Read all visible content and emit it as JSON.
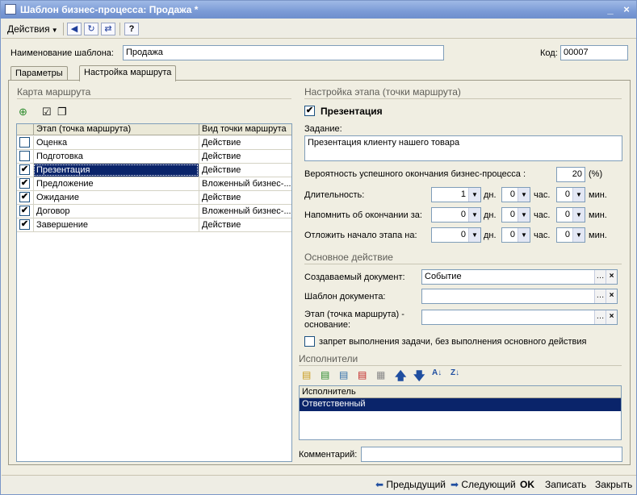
{
  "window": {
    "title": "Шаблон бизнес-процесса: Продажа *"
  },
  "toolbar": {
    "actions_label": "Действия"
  },
  "form": {
    "name_label": "Наименование шаблона:",
    "name_value": "Продажа",
    "code_label": "Код:",
    "code_value": "00007"
  },
  "tabs": [
    {
      "label": "Параметры"
    },
    {
      "label": "Настройка маршрута"
    }
  ],
  "route_map": {
    "title": "Карта маршрута",
    "columns": [
      "Этап (точка маршрута)",
      "Вид точки маршрута"
    ],
    "rows": [
      {
        "name": "Оценка",
        "type": "Действие",
        "checked": false
      },
      {
        "name": "Подготовка",
        "type": "Действие",
        "checked": false
      },
      {
        "name": "Презентация",
        "type": "Действие",
        "checked": true
      },
      {
        "name": "Предложение",
        "type": "Вложенный бизнес-...",
        "checked": true
      },
      {
        "name": "Ожидание",
        "type": "Действие",
        "checked": true
      },
      {
        "name": "Договор",
        "type": "Вложенный бизнес-...",
        "checked": true
      },
      {
        "name": "Завершение",
        "type": "Действие",
        "checked": true
      }
    ]
  },
  "stage": {
    "section_title": "Настройка этапа (точки маршрута)",
    "stage_name": "Презентация",
    "task_label": "Задание:",
    "task_value": "Презентация клиенту нашего товара",
    "probability_label": "Вероятность успешного окончания бизнес-процесса :",
    "probability_value": "20",
    "probability_unit": "(%)",
    "duration_label": "Длительность:",
    "remind_label": "Напомнить об окончании за:",
    "delay_label": "Отложить начало этапа на:",
    "unit_days": "дн.",
    "unit_hours": "час.",
    "unit_minutes": "мин.",
    "duration": {
      "days": "1",
      "hours": "0",
      "minutes": "0"
    },
    "remind": {
      "days": "0",
      "hours": "0",
      "minutes": "0"
    },
    "delay": {
      "days": "0",
      "hours": "0",
      "minutes": "0"
    }
  },
  "main_action": {
    "section_title": "Основное действие",
    "doc_label": "Создаваемый документ:",
    "doc_value": "Событие",
    "template_label": "Шаблон документа:",
    "template_value": "",
    "base_label_1": "Этап (точка маршрута) -",
    "base_label_2": "основание:",
    "base_value": "",
    "prohibit_label": "запрет выполнения задачи, без выполнения основного действия"
  },
  "executors": {
    "section_title": "Исполнители",
    "column": "Исполнитель",
    "rows": [
      "Ответственный"
    ]
  },
  "comment": {
    "label": "Комментарий:",
    "value": ""
  },
  "bottom": {
    "prev": "Предыдущий",
    "next": "Следующий",
    "ok": "OK",
    "save": "Записать",
    "close": "Закрыть"
  },
  "colors": {
    "selection": "#0a246a",
    "title_gradient_start": "#9fb9e6",
    "accent_green": "#21a121"
  }
}
